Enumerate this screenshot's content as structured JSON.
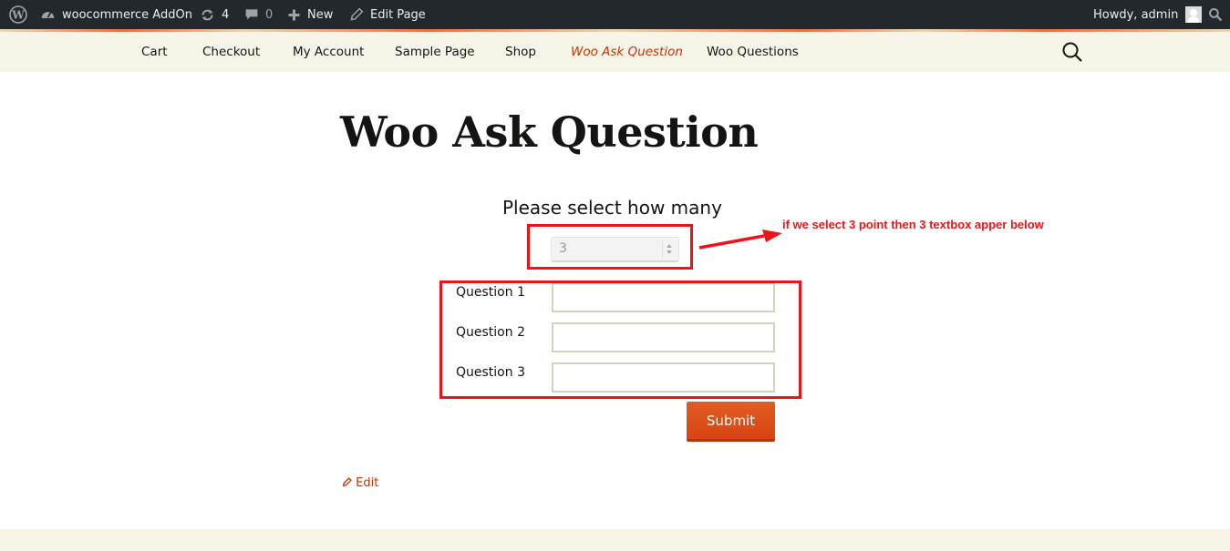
{
  "admin_bar": {
    "site_name": "woocommerce AddOn",
    "updates_count": "4",
    "comments_count": "0",
    "new_label": "New",
    "edit_page_label": "Edit Page",
    "greeting": "Howdy, admin"
  },
  "nav": {
    "items": [
      {
        "label": "Cart",
        "current": false
      },
      {
        "label": "Checkout",
        "current": false
      },
      {
        "label": "My Account",
        "current": false
      },
      {
        "label": "Sample Page",
        "current": false
      },
      {
        "label": "Shop",
        "current": false
      },
      {
        "label": "Woo Ask Question",
        "current": true
      },
      {
        "label": "Woo Questions",
        "current": false
      }
    ],
    "search_icon": "search-icon"
  },
  "page": {
    "title": "Woo Ask Question",
    "select_prompt": "Please select how many",
    "selected_count": "3",
    "questions": [
      {
        "label": "Question 1",
        "value": ""
      },
      {
        "label": "Question 2",
        "value": ""
      },
      {
        "label": "Question 3",
        "value": ""
      }
    ],
    "submit_label": "Submit",
    "edit_label": "Edit"
  },
  "annotation": {
    "note": "if we select 3 point then 3 textbox apper below",
    "color": "#e8161b"
  },
  "colors": {
    "admin_bar_bg": "#23282d",
    "nav_bg": "#f7f5e7",
    "accent": "#bc360a",
    "button": "#e05d22"
  }
}
